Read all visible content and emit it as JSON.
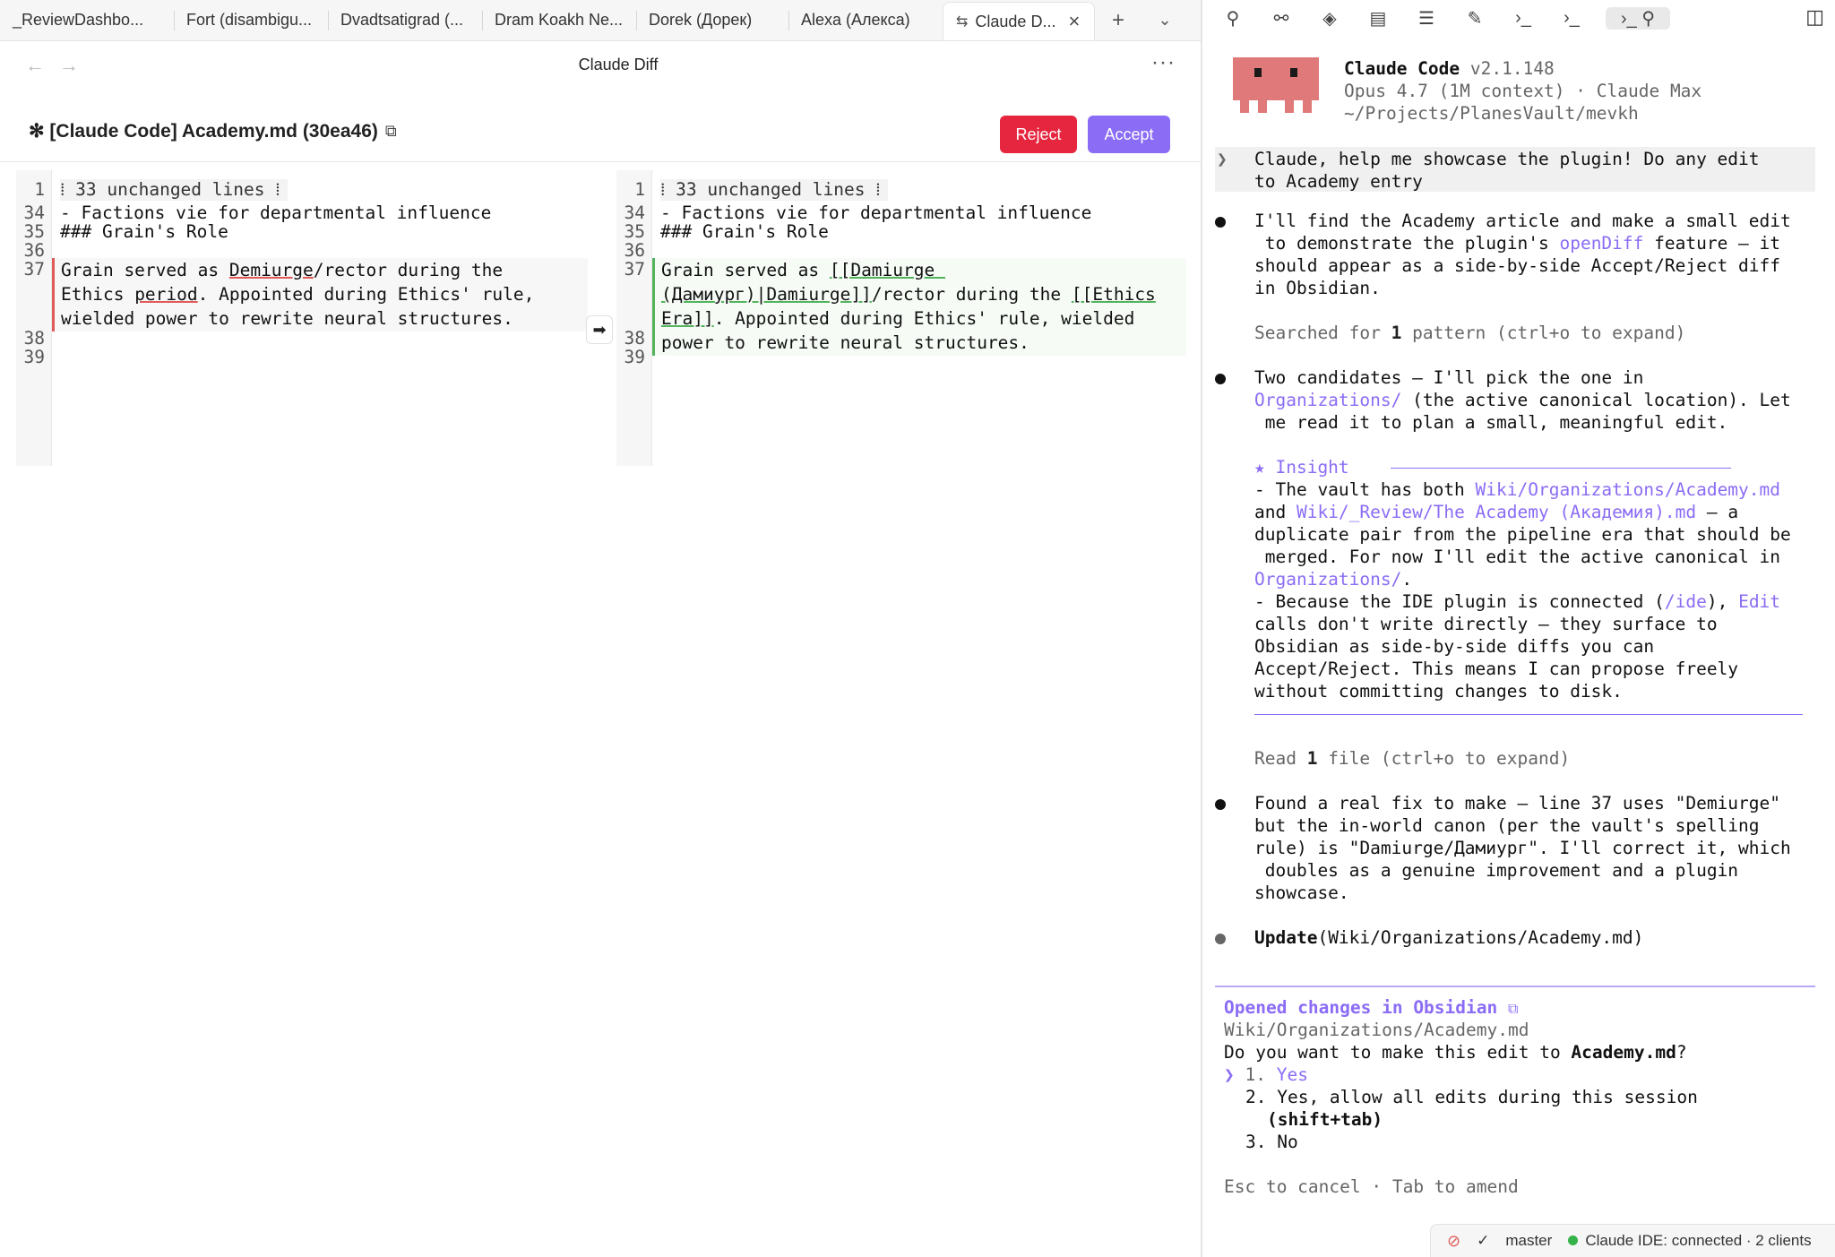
{
  "tabs": [
    {
      "label": "_ReviewDashbo..."
    },
    {
      "label": "Fort (disambigu..."
    },
    {
      "label": "Dvadtsatigrad (..."
    },
    {
      "label": "Dram Koakh Ne..."
    },
    {
      "label": "Dorek (Дорек)"
    },
    {
      "label": "Alexa (Алекса)"
    },
    {
      "label": "Claude D...",
      "icon": "git-compare-icon",
      "active": true
    }
  ],
  "view": {
    "title": "Claude Diff",
    "diff_title": "✻ [Claude Code] Academy.md (30ea46)",
    "reject_label": "Reject",
    "accept_label": "Accept"
  },
  "diff": {
    "left": {
      "unchanged": "⁞ 33 unchanged lines ⁞",
      "lines": [
        {
          "n": "1"
        },
        {
          "n": "34",
          "text": "- Factions vie for departmental influence"
        },
        {
          "n": "35",
          "text": "### Grain's Role"
        },
        {
          "n": "36",
          "text": ""
        },
        {
          "n": "37"
        },
        {
          "n": "38",
          "text": ""
        },
        {
          "n": "39",
          "text": ""
        }
      ],
      "changed_l1_a": "Grain served as ",
      "changed_l1_b": "Demiurge",
      "changed_l1_c": "/rector during the",
      "changed_l2_a": "Ethics ",
      "changed_l2_b": "period",
      "changed_l2_c": ". Appointed during Ethics' rule,",
      "changed_l3": "wielded power to rewrite neural structures."
    },
    "right": {
      "unchanged": "⁞ 33 unchanged lines ⁞",
      "lines": [
        {
          "n": "1"
        },
        {
          "n": "34",
          "text": "- Factions vie for departmental influence"
        },
        {
          "n": "35",
          "text": "### Grain's Role"
        },
        {
          "n": "36",
          "text": ""
        },
        {
          "n": "37"
        },
        {
          "n": "38",
          "text": ""
        },
        {
          "n": "39",
          "text": ""
        }
      ],
      "changed_l1_a": "Grain served as ",
      "changed_l1_b": "[[Damiurge ",
      "changed_l2_a": "(Дамиург)|Damiurge]]",
      "changed_l2_b": "/rector during the ",
      "changed_l2_c": "[[Ethics",
      "changed_l3_a": "Era]]",
      "changed_l3_b": ". Appointed during Ethics' rule, wielded",
      "changed_l4": "power to rewrite neural structures."
    },
    "arrow": "➡"
  },
  "terminal": {
    "header": {
      "app": "Claude Code",
      "version": " v2.1.148",
      "model": "Opus 4.7 (1M context) · Claude Max",
      "path": "~/Projects/PlanesVault/mevkh"
    },
    "prompt_marker": "❯",
    "prompt_l1": "Claude, help me showcase the plugin! Do any edit",
    "prompt_l2": "to Academy entry",
    "m1_l1": "I'll find the Academy article and make a small edit",
    "m1_l2a": " to demonstrate the plugin's ",
    "m1_l2b": "openDiff",
    "m1_l2c": " feature — it",
    "m1_l3": "should appear as a side-by-side Accept/Reject diff",
    "m1_l4": "in Obsidian.",
    "search_a": "Searched for ",
    "search_b": "1",
    "search_c": " pattern (ctrl+o to expand)",
    "m2_l1": "Two candidates — I'll pick the one in",
    "m2_l2a": "Organizations/",
    "m2_l2b": " (the active canonical location). Let",
    "m2_l3": " me read it to plan a small, meaningful edit.",
    "insight_title": "★ Insight",
    "ins_l1a": "- The vault has both ",
    "ins_l1b": "Wiki/Organizations/Academy.md",
    "ins_l2a": "and ",
    "ins_l2b": "Wiki/_Review/The Academy (Академия).md",
    "ins_l2c": " — a",
    "ins_l3": "duplicate pair from the pipeline era that should be",
    "ins_l4": " merged. For now I'll edit the active canonical in",
    "ins_l5a": "Organizations/",
    "ins_l5b": ".",
    "ins_l6a": "- Because the IDE plugin is connected (",
    "ins_l6b": "/ide",
    "ins_l6c": "), ",
    "ins_l6d": "Edit",
    "ins_l7": "calls don't write directly — they surface to",
    "ins_l8": "Obsidian as side-by-side diffs you can",
    "ins_l9": "Accept/Reject. This means I can propose freely",
    "ins_l10": "without committing changes to disk.",
    "read_a": "Read ",
    "read_b": "1",
    "read_c": " file (ctrl+o to expand)",
    "m3_l1": "Found a real fix to make — line 37 uses \"Demiurge\"",
    "m3_l2": "but the in-world canon (per the vault's spelling",
    "m3_l3": "rule) is \"Damiurge/Дамиург\". I'll correct it, which",
    "m3_l4": " doubles as a genuine improvement and a plugin",
    "m3_l5": "showcase.",
    "update_a": "Update",
    "update_b": "(Wiki/Organizations/Academy.md)",
    "opened": "Opened changes in Obsidian",
    "opened_path": "Wiki/Organizations/Academy.md",
    "question_a": "Do you want to make this edit to ",
    "question_b": "Academy.md",
    "question_c": "?",
    "opt_marker": "❯",
    "opt1_num": "1. ",
    "opt1": "Yes",
    "opt2": "2. Yes, allow all edits during this session",
    "opt2b": "(shift+tab)",
    "opt3": "3. No",
    "footer": "Esc to cancel · Tab to amend"
  },
  "status": {
    "branch": "master",
    "ide": "Claude IDE: connected · 2 clients"
  },
  "colors": {
    "accent": "#8b6cf5",
    "reject": "#e5263e",
    "deleted": "#e05a5a",
    "added": "#52b35c",
    "mascot": "#e07a7a",
    "connected": "#35b34a"
  }
}
